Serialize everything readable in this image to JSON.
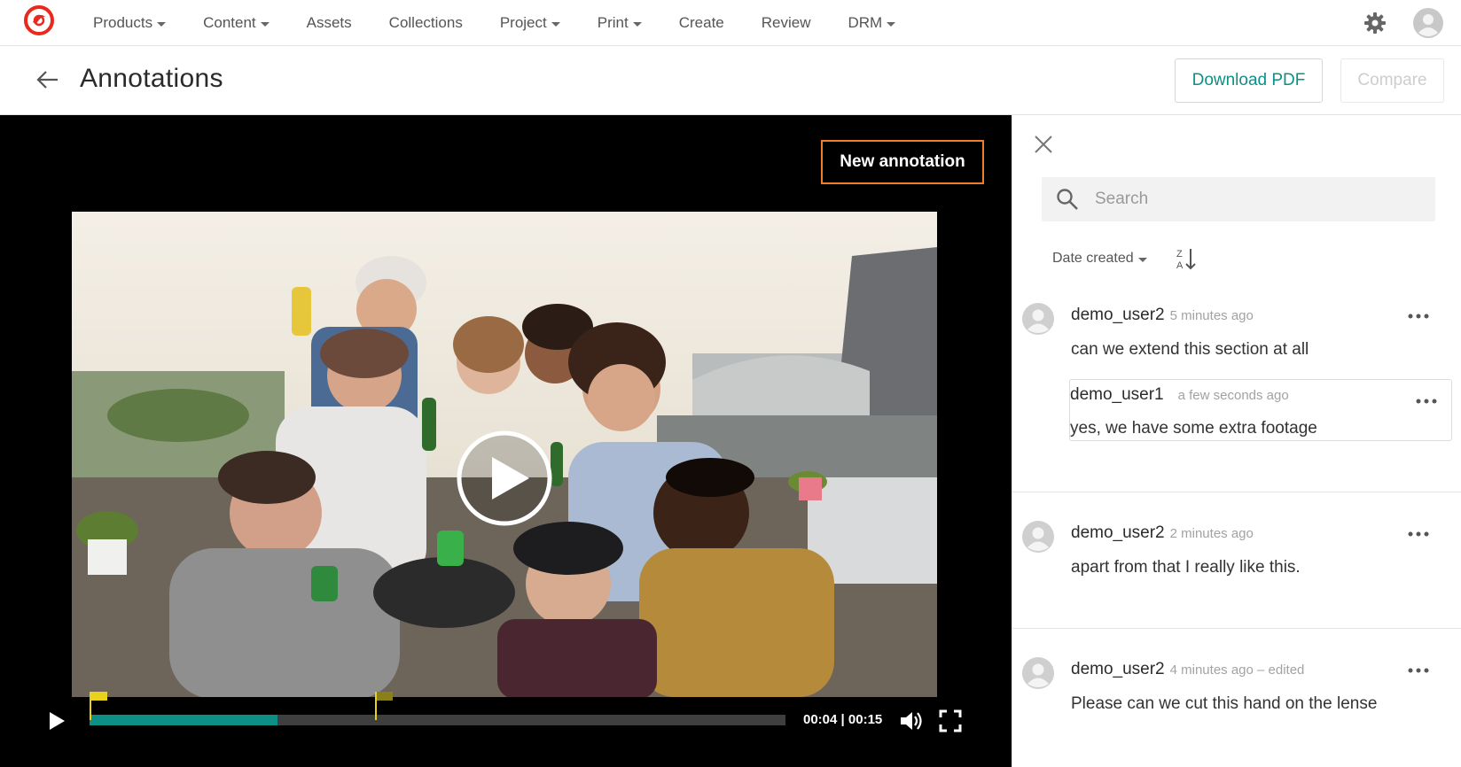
{
  "nav": {
    "items": [
      {
        "label": "Products",
        "dropdown": true
      },
      {
        "label": "Content",
        "dropdown": true
      },
      {
        "label": "Assets",
        "dropdown": false
      },
      {
        "label": "Collections",
        "dropdown": false
      },
      {
        "label": "Project",
        "dropdown": true
      },
      {
        "label": "Print",
        "dropdown": true
      },
      {
        "label": "Create",
        "dropdown": false
      },
      {
        "label": "Review",
        "dropdown": false
      },
      {
        "label": "DRM",
        "dropdown": true
      }
    ]
  },
  "header": {
    "title": "Annotations",
    "download_label": "Download PDF",
    "compare_label": "Compare"
  },
  "player": {
    "new_annotation_label": "New annotation",
    "current_time": "00:04",
    "duration": "00:15",
    "timecode": "00:04 | 00:15",
    "progress_fraction": 0.27,
    "annotation_marker_fractions": [
      0.0,
      0.41
    ]
  },
  "panel": {
    "search_placeholder": "Search",
    "sort_label": "Date created",
    "comments": [
      {
        "user": "demo_user2",
        "time": "5 minutes ago",
        "text": "can we extend this section at all",
        "reply": {
          "user": "demo_user1",
          "time": "a few seconds ago",
          "text": "yes, we have some extra footage"
        }
      },
      {
        "user": "demo_user2",
        "time": "2 minutes ago",
        "text": "apart from that I really like this."
      },
      {
        "user": "demo_user2",
        "time": "4 minutes ago – edited",
        "text": "Please can we cut this hand on the lense"
      }
    ]
  },
  "colors": {
    "accent": "#0e8f86",
    "highlight": "#f07d2a",
    "brand": "#e8291c",
    "marker": "#e8d21c"
  },
  "icons": [
    "logo-icon",
    "gear-icon",
    "user-avatar-icon",
    "back-arrow-icon",
    "play-icon",
    "volume-icon",
    "fullscreen-icon",
    "close-icon",
    "search-icon",
    "sort-az-icon",
    "more-icon"
  ]
}
